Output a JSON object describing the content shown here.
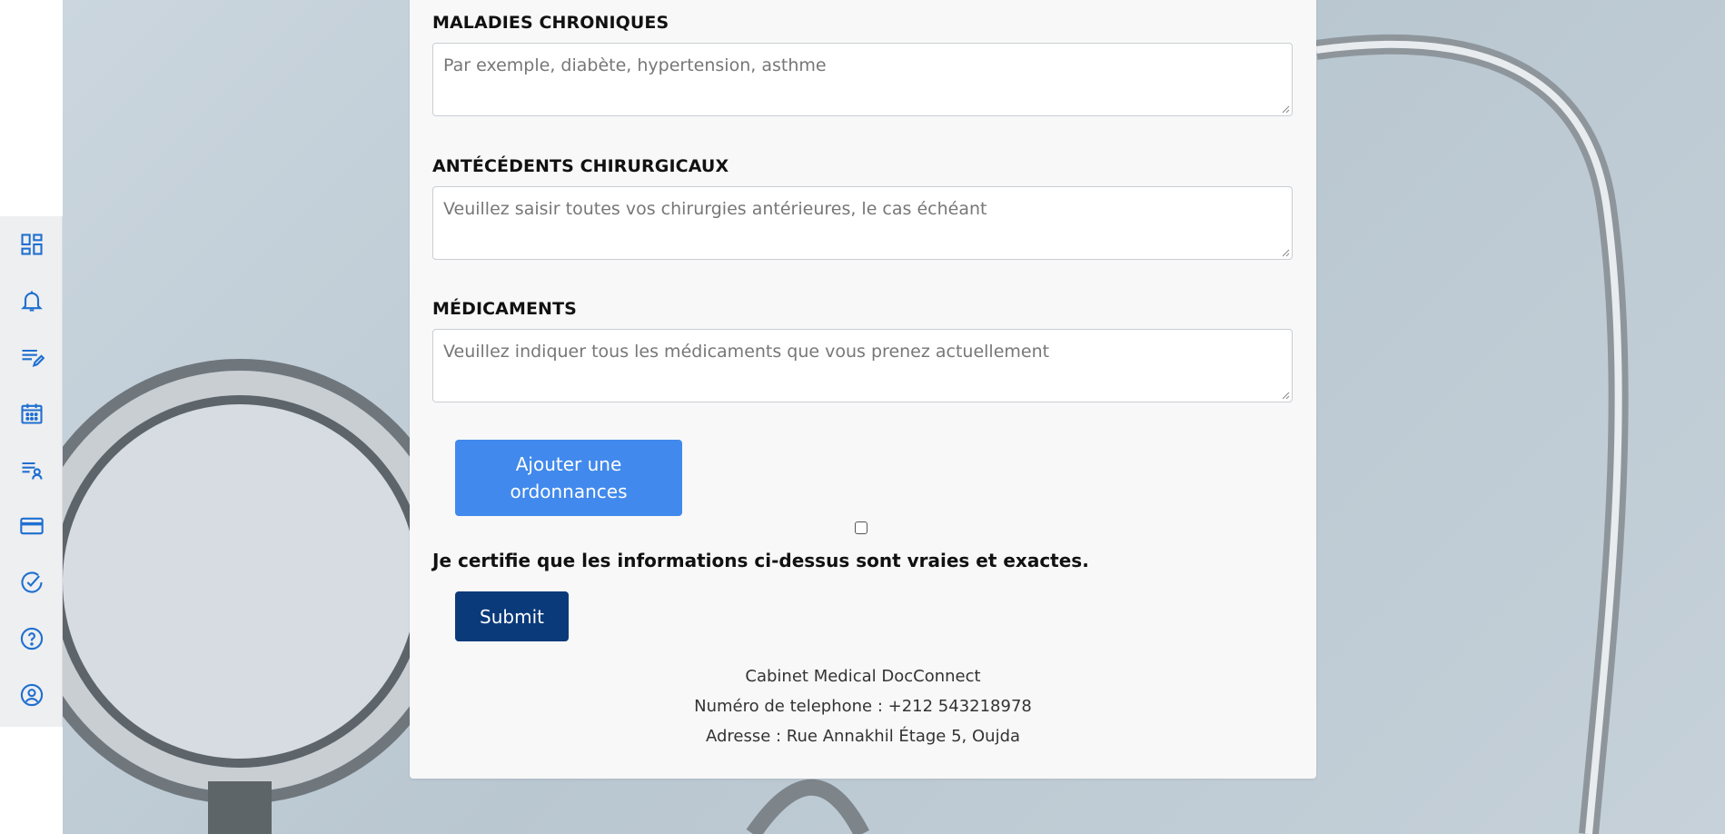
{
  "sidebar": {
    "items": [
      {
        "icon": "dashboard-icon"
      },
      {
        "icon": "bell-icon"
      },
      {
        "icon": "edit-note-icon"
      },
      {
        "icon": "calendar-icon"
      },
      {
        "icon": "patient-list-icon"
      },
      {
        "icon": "credit-card-icon"
      },
      {
        "icon": "check-circle-icon"
      },
      {
        "icon": "help-icon"
      },
      {
        "icon": "account-icon"
      }
    ],
    "accent": "#1f6fd0"
  },
  "form": {
    "chronic": {
      "label": "MALADIES CHRONIQUES",
      "placeholder": "Par exemple, diabète, hypertension, asthme"
    },
    "surgical": {
      "label": "ANTÉCÉDENTS CHIRURGICAUX",
      "placeholder": "Veuillez saisir toutes vos chirurgies antérieures, le cas échéant"
    },
    "medications": {
      "label": "MÉDICAMENTS",
      "placeholder": "Veuillez indiquer tous les médicaments que vous prenez actuellement"
    },
    "add_prescription_label": "Ajouter une ordonnances",
    "certify_label": "Je certifie que les informations ci-dessus sont vraies et exactes.",
    "submit_label": "Submit"
  },
  "footer": {
    "name": "Cabinet Medical DocConnect",
    "phone": "Numéro de telephone : +212 543218978",
    "address": "Adresse : Rue Annakhil Étage 5, Oujda"
  },
  "colors": {
    "primary_button": "#4189ec",
    "submit_button": "#0b3a7a"
  }
}
